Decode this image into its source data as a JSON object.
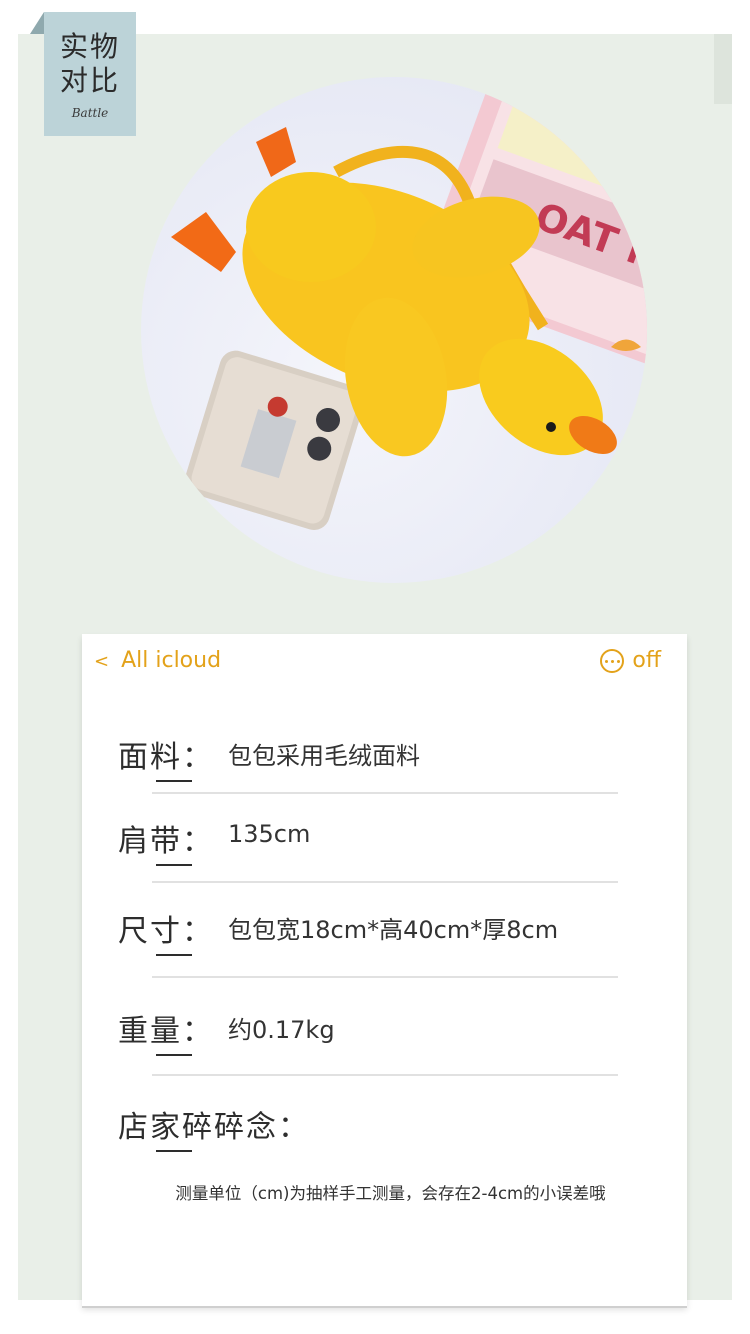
{
  "tag": {
    "title": "实物\n对比",
    "subtitle": "Battle"
  },
  "photo": {
    "alt": "Yellow plush duck shoulder bag next to a phone"
  },
  "card": {
    "back_label": "All icloud",
    "back_chevron": "<",
    "menu_label": "off",
    "rows": [
      {
        "label": "面料",
        "colon": "：",
        "value": "包包采用毛绒面料"
      },
      {
        "label": "肩带",
        "colon": "：",
        "value": "135cm"
      },
      {
        "label": "尺寸",
        "colon": "：",
        "value": "包包宽18cm*高40cm*厚8cm"
      },
      {
        "label": "重量",
        "colon": "：",
        "value": "约0.17kg"
      },
      {
        "label": "店家碎碎念",
        "colon": "：",
        "value": ""
      }
    ],
    "note": "测量单位（cm)为抽样手工测量，会存在2-4cm的小误差哦"
  },
  "colors": {
    "accent": "#e3a21a",
    "tag": "#bcd3d8",
    "background": "#e9efe8"
  },
  "icons": {
    "more": "more-dots-icon",
    "back": "chevron-left-icon"
  }
}
